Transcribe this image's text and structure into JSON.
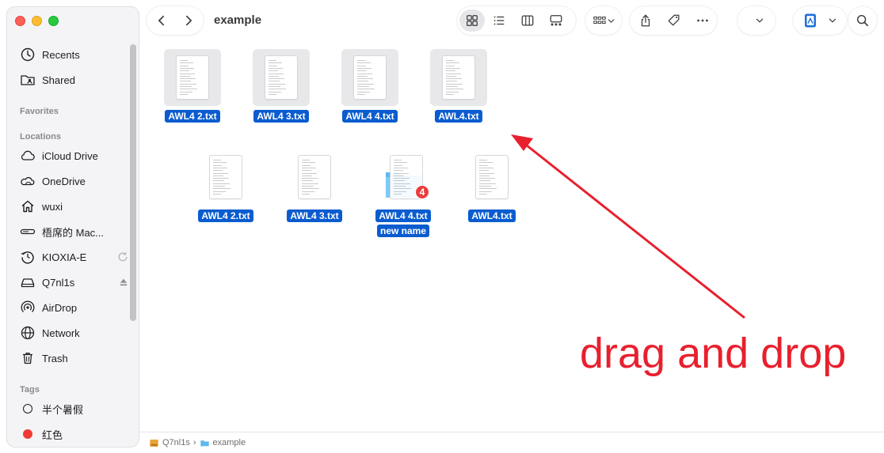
{
  "window": {
    "title": "example"
  },
  "sidebar": {
    "top_items": [
      {
        "label": "Recents",
        "icon": "clock-icon"
      },
      {
        "label": "Shared",
        "icon": "shared-folder-icon"
      }
    ],
    "favorites_heading": "Favorites",
    "locations_heading": "Locations",
    "locations": [
      {
        "label": "iCloud Drive",
        "icon": "cloud-icon"
      },
      {
        "label": "OneDrive",
        "icon": "onedrive-cloud-icon"
      },
      {
        "label": "wuxi",
        "icon": "home-icon"
      },
      {
        "label": "梧席的 Mac...",
        "icon": "computer-icon"
      },
      {
        "label": "KIOXIA-E",
        "icon": "time-machine-icon"
      },
      {
        "label": "Q7nl1s",
        "icon": "drive-icon"
      },
      {
        "label": "AirDrop",
        "icon": "airdrop-icon"
      },
      {
        "label": "Network",
        "icon": "globe-icon"
      },
      {
        "label": "Trash",
        "icon": "trash-icon"
      }
    ],
    "tags_heading": "Tags",
    "tags": [
      {
        "label": "半个暑假",
        "color": "none"
      },
      {
        "label": "红色",
        "color": "#ee3b36"
      }
    ]
  },
  "files": {
    "row1": [
      "AWL4 2.txt",
      "AWL4 3.txt",
      "AWL4 4.txt",
      "AWL4.txt"
    ],
    "row2": [
      "AWL4 2.txt",
      "AWL4 3.txt",
      "AWL4 4.txt",
      "AWL4.txt"
    ],
    "drag_new_folder_name": "new name",
    "drag_count_badge": "4"
  },
  "annotation": {
    "text": "drag and drop",
    "color": "#e8202e"
  },
  "pathbar": {
    "segments": [
      "Q7nl1s",
      "example"
    ],
    "separator": "›"
  }
}
